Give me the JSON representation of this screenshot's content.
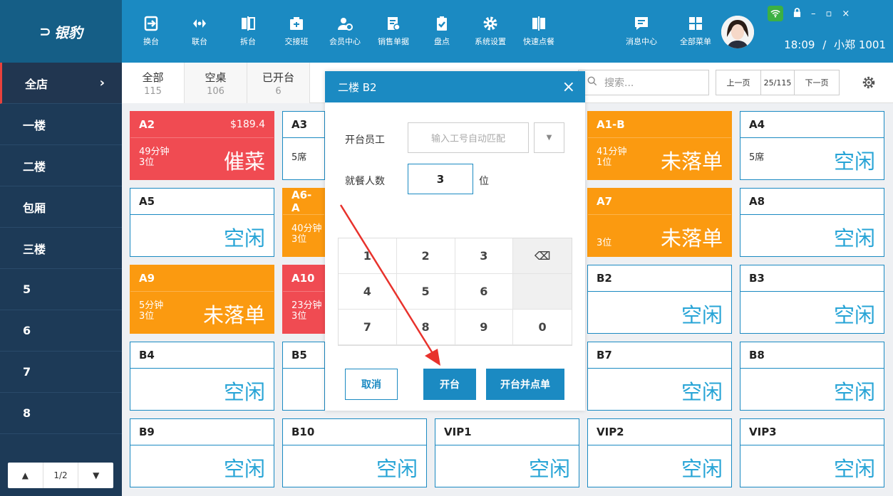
{
  "brand": {
    "name": "银豹"
  },
  "toolbar": [
    {
      "id": "swap",
      "label": "换台"
    },
    {
      "id": "merge",
      "label": "联台"
    },
    {
      "id": "split",
      "label": "拆台"
    },
    {
      "id": "shift",
      "label": "交接班"
    },
    {
      "id": "member",
      "label": "会员中心"
    },
    {
      "id": "sales",
      "label": "销售单据"
    },
    {
      "id": "stock",
      "label": "盘点"
    },
    {
      "id": "settings",
      "label": "系统设置"
    },
    {
      "id": "quick",
      "label": "快速点餐"
    }
  ],
  "toolbar_right": [
    {
      "id": "messages",
      "label": "消息中心"
    },
    {
      "id": "menu",
      "label": "全部菜单"
    }
  ],
  "status": {
    "time": "18:09",
    "sep": "/",
    "user": "小郑 1001"
  },
  "sidebar": {
    "items": [
      "全店",
      "一楼",
      "二楼",
      "包厢",
      "三楼",
      "5",
      "6",
      "7",
      "8"
    ],
    "pager": {
      "up": "▲",
      "page": "1/2",
      "down": "▼"
    }
  },
  "tabs": [
    {
      "label": "全部",
      "count": "115"
    },
    {
      "label": "空桌",
      "count": "106"
    },
    {
      "label": "已开台",
      "count": "6"
    }
  ],
  "search": {
    "placeholder": "搜索..."
  },
  "paging": {
    "prev": "上一页",
    "page": "25/115",
    "next": "下一页"
  },
  "tables": {
    "A2": {
      "name": "A2",
      "amount": "$189.4",
      "time": "49分钟",
      "guests": "3位",
      "status": "催菜"
    },
    "A3": {
      "name": "A3",
      "seats": "5席"
    },
    "A1B": {
      "name": "A1-B",
      "time": "41分钟",
      "guests": "1位",
      "status": "未落单"
    },
    "A4": {
      "name": "A4",
      "seats": "5席",
      "status": "空闲"
    },
    "A5": {
      "name": "A5",
      "status": "空闲"
    },
    "A6A": {
      "name": "A6-A",
      "time": "40分钟",
      "guests": "3位"
    },
    "A7": {
      "name": "A7",
      "guests": "3位",
      "status": "未落单"
    },
    "A8": {
      "name": "A8",
      "status": "空闲"
    },
    "A9": {
      "name": "A9",
      "time": "5分钟",
      "guests": "3位",
      "status": "未落单"
    },
    "A10": {
      "name": "A10",
      "time": "23分钟",
      "guests": "3位"
    },
    "B2": {
      "name": "B2",
      "status": "空闲"
    },
    "B3": {
      "name": "B3",
      "status": "空闲"
    },
    "B4": {
      "name": "B4",
      "status": "空闲"
    },
    "B5": {
      "name": "B5"
    },
    "B7": {
      "name": "B7",
      "status": "空闲"
    },
    "B8": {
      "name": "B8",
      "status": "空闲"
    },
    "B9": {
      "name": "B9",
      "status": "空闲"
    },
    "B10": {
      "name": "B10",
      "status": "空闲"
    },
    "VIP1": {
      "name": "VIP1",
      "status": "空闲"
    },
    "VIP2": {
      "name": "VIP2",
      "status": "空闲"
    },
    "VIP3": {
      "name": "VIP3",
      "status": "空闲"
    }
  },
  "modal": {
    "title": "二楼 B2",
    "close": "×",
    "staff_label": "开台员工",
    "staff_placeholder": "输入工号自动匹配",
    "guests_label": "就餐人数",
    "guests_value": "3",
    "guests_unit": "位",
    "keys": [
      "1",
      "2",
      "3",
      "⌫",
      "4",
      "5",
      "6",
      "",
      "7",
      "8",
      "9",
      "0"
    ],
    "cancel": "取消",
    "open": "开台",
    "open_order": "开台并点单"
  },
  "colors": {
    "primary": "#1b8ac2",
    "red": "#f04b52",
    "orange": "#fb9a10",
    "sidebar": "#1d3a57"
  }
}
